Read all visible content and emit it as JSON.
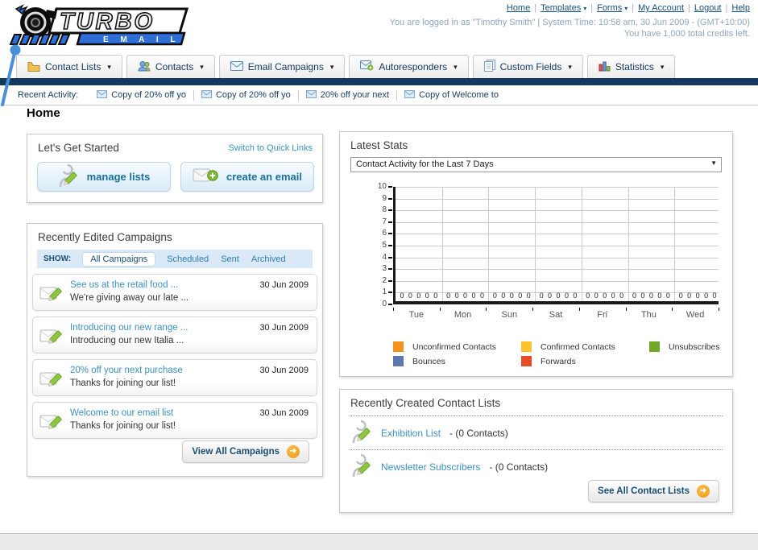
{
  "header": {
    "logo": {
      "line1": "TURBO",
      "line2": "E M A I L"
    },
    "nav_links": [
      {
        "label": "Home",
        "dropdown": false
      },
      {
        "label": "Templates",
        "dropdown": true
      },
      {
        "label": "Forms",
        "dropdown": true
      },
      {
        "label": "My Account",
        "dropdown": false
      },
      {
        "label": "Logout",
        "dropdown": false
      },
      {
        "label": "Help",
        "dropdown": false
      }
    ],
    "login_info": "You are logged in as \"Timothy Smith\" | System Time: 10:58 am, 30 Jun 2009 - (GMT+10:00)",
    "credits_info": "You have 1,000 total credits left."
  },
  "nav_tabs": [
    {
      "label": "Contact Lists",
      "icon": "address-book"
    },
    {
      "label": "Contacts",
      "icon": "contacts"
    },
    {
      "label": "Email Campaigns",
      "icon": "envelope"
    },
    {
      "label": "Autoresponders",
      "icon": "envelope-go"
    },
    {
      "label": "Custom Fields",
      "icon": "fields"
    },
    {
      "label": "Statistics",
      "icon": "stats"
    }
  ],
  "recent_activity": {
    "label": "Recent Activity:",
    "items": [
      "Copy of 20% off yo",
      "Copy of 20% off yo",
      "20% off your next",
      "Copy of Welcome to"
    ]
  },
  "page_title": "Home",
  "get_started": {
    "title": "Let's Get Started",
    "switch_link": "Switch to Quick Links",
    "buttons": [
      {
        "label": "manage lists",
        "icon": "person-edit"
      },
      {
        "label": "create an email",
        "icon": "mail-add"
      }
    ]
  },
  "campaigns": {
    "title": "Recently Edited Campaigns",
    "show_label": "SHOW:",
    "tabs": [
      "All Campaigns",
      "Scheduled",
      "Sent",
      "Archived"
    ],
    "active_tab": "All Campaigns",
    "items": [
      {
        "title": "See us at the retail food ...",
        "subtitle": "We're giving away our late ...",
        "date": "30 Jun 2009"
      },
      {
        "title": "Introducing our new range ...",
        "subtitle": "Introducing our new Italia ...",
        "date": "30 Jun 2009"
      },
      {
        "title": "20% off your next purchase",
        "subtitle": "Thanks for joining our list!",
        "date": "30 Jun 2009"
      },
      {
        "title": "Welcome to our email list",
        "subtitle": "Thanks for joining our list!",
        "date": "30 Jun 2009"
      }
    ],
    "view_all_label": "View All Campaigns"
  },
  "stats": {
    "title": "Latest Stats",
    "dropdown_value": "Contact Activity for the Last 7 Days"
  },
  "chart_data": {
    "type": "bar",
    "title": "Contact Activity for the Last 7 Days",
    "categories": [
      "Tue",
      "Mon",
      "Sun",
      "Sat",
      "Fri",
      "Thu",
      "Wed"
    ],
    "series": [
      {
        "name": "Unconfirmed Contacts",
        "color": "#F6921E",
        "values": [
          0,
          0,
          0,
          0,
          0,
          0,
          0
        ]
      },
      {
        "name": "Confirmed Contacts",
        "color": "#FDC32B",
        "values": [
          0,
          0,
          0,
          0,
          0,
          0,
          0
        ]
      },
      {
        "name": "Unsubscribes",
        "color": "#71A826",
        "values": [
          0,
          0,
          0,
          0,
          0,
          0,
          0
        ]
      },
      {
        "name": "Bounces",
        "color": "#5C77AE",
        "values": [
          0,
          0,
          0,
          0,
          0,
          0,
          0
        ]
      },
      {
        "name": "Forwards",
        "color": "#E74C28",
        "values": [
          0,
          0,
          0,
          0,
          0,
          0,
          0
        ]
      }
    ],
    "ylim": [
      0,
      10
    ],
    "ytick_step": 1,
    "grid": true,
    "value_labels": "0",
    "legend_position": "bottom"
  },
  "contact_lists": {
    "title": "Recently Created Contact Lists",
    "items": [
      {
        "name": "Exhibition List",
        "detail": "- (0 Contacts)"
      },
      {
        "name": "Newsletter Subscribers",
        "detail": "- (0 Contacts)"
      }
    ],
    "see_all_label": "See All Contact Lists"
  }
}
